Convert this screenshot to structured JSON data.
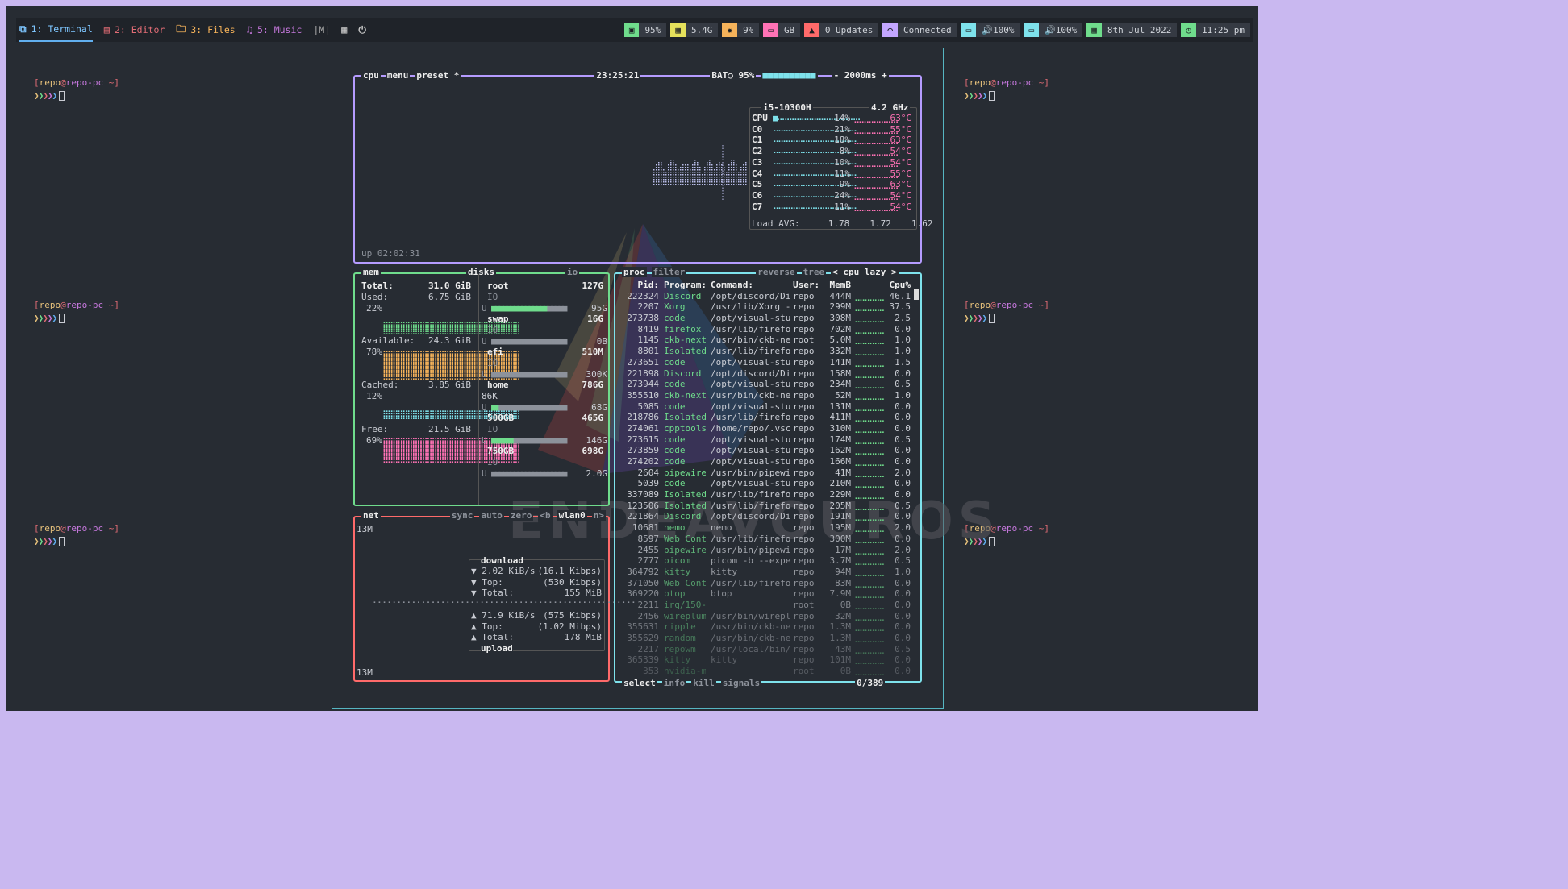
{
  "workspaces": [
    {
      "num": "1: Terminal",
      "icon": "terminal-icon",
      "glyph": "⧉",
      "color": "#7ec6ff",
      "active": true
    },
    {
      "num": "2: Editor",
      "icon": "editor-icon",
      "glyph": "▤",
      "color": "#e06c75"
    },
    {
      "num": "3: Files",
      "icon": "folder-icon",
      "glyph": "🗀",
      "color": "#f6b35a"
    },
    {
      "num": "5: Music",
      "icon": "music-icon",
      "glyph": "♫",
      "color": "#c678dd"
    }
  ],
  "mode": "|M|",
  "modules": [
    {
      "name": "cpu",
      "icon": "cpu-icon",
      "glyph": "▣",
      "color": "#6fdc8c",
      "text": "95%"
    },
    {
      "name": "memory",
      "icon": "memory-icon",
      "glyph": "▦",
      "color": "#e5e15b",
      "text": "5.4G"
    },
    {
      "name": "temperature",
      "icon": "temperature-icon",
      "glyph": "✹",
      "color": "#f6b35a",
      "text": "9%"
    },
    {
      "name": "disk",
      "icon": "disk-icon",
      "glyph": "▭",
      "color": "#ff72b5",
      "text": "GB"
    },
    {
      "name": "updates",
      "icon": "updates-icon",
      "glyph": "▲",
      "color": "#ff6a6a",
      "text": "0 Updates"
    },
    {
      "name": "network",
      "icon": "wifi-icon",
      "glyph": "◠",
      "color": "#c3a6ff",
      "text": "Connected"
    },
    {
      "name": "volume1",
      "icon": "laptop-icon",
      "glyph": "▭",
      "color": "#7ee2ec",
      "text": "🔊100%"
    },
    {
      "name": "volume2",
      "icon": "monitor-icon",
      "glyph": "▭",
      "color": "#7ee2ec",
      "text": "🔊100%"
    },
    {
      "name": "date",
      "icon": "calendar-icon",
      "glyph": "▦",
      "color": "#6fdc8c",
      "text": "8th Jul 2022"
    },
    {
      "name": "clock",
      "icon": "clock-icon",
      "glyph": "◷",
      "color": "#6fdc8c",
      "text": "11:25 pm"
    }
  ],
  "prompt": {
    "user": "repo",
    "host": "repo-pc",
    "dir": "~"
  },
  "cpu": {
    "tabs": [
      "cpu",
      "menu",
      "preset *"
    ],
    "time": "23:25:21",
    "bat": "BAT○ 95%",
    "interval": "- 2000ms +",
    "uptime": "up 02:02:31",
    "model": "i5-10300H",
    "freq": "4.2 GHz",
    "cores": [
      {
        "n": "CPU",
        "p": "14%",
        "t": "63°C"
      },
      {
        "n": "C0",
        "p": "21%",
        "t": "55°C"
      },
      {
        "n": "C1",
        "p": "18%",
        "t": "63°C"
      },
      {
        "n": "C2",
        "p": "8%",
        "t": "54°C"
      },
      {
        "n": "C3",
        "p": "10%",
        "t": "54°C"
      },
      {
        "n": "C4",
        "p": "11%",
        "t": "55°C"
      },
      {
        "n": "C5",
        "p": "9%",
        "t": "63°C"
      },
      {
        "n": "C6",
        "p": "24%",
        "t": "54°C"
      },
      {
        "n": "C7",
        "p": "11%",
        "t": "54°C"
      }
    ],
    "load_label": "Load AVG:",
    "load": [
      "1.78",
      "1.72",
      "1.62"
    ]
  },
  "mem": {
    "title": "mem",
    "total_l": "Total:",
    "total": "31.0 GiB",
    "used_l": "Used:",
    "used": "6.75 GiB",
    "used_p": "22%",
    "avail_l": "Available:",
    "avail": "24.3 GiB",
    "avail_p": "78%",
    "cached_l": "Cached:",
    "cached": "3.85 GiB",
    "cached_p": "12%",
    "free_l": "Free:",
    "free": "21.5 GiB",
    "free_p": "69%"
  },
  "disks": {
    "title": "disks",
    "io": "io",
    "list": [
      {
        "name": "root",
        "size": "127G",
        "u": "95G",
        "fill": 0.75
      },
      {
        "name": "swap",
        "size": "16G",
        "u": "0B",
        "fill": 0.0
      },
      {
        "name": "efi",
        "size": "510M",
        "u": "300K",
        "fill": 0.0
      },
      {
        "name": "home",
        "size": "786G",
        "u": "68G",
        "fill": 0.09,
        "extra": "86K"
      },
      {
        "name": "500GB",
        "size": "465G",
        "u": "146G",
        "fill": 0.31
      },
      {
        "name": "750GB",
        "size": "698G",
        "u": "2.0G",
        "fill": 0.0
      }
    ]
  },
  "net": {
    "title": "net",
    "tabs": [
      "sync",
      "auto",
      "zero",
      "<b",
      "wlan0",
      "n>"
    ],
    "scale_top": "13M",
    "scale_bot": "13M",
    "download": "download",
    "upload": "upload",
    "dl": [
      [
        "▼ 2.02 KiB/s",
        "(16.1 Kibps)"
      ],
      [
        "▼ Top:",
        "(530 Kibps)"
      ],
      [
        "▼ Total:",
        "155 MiB"
      ]
    ],
    "ul": [
      [
        "▲ 71.9 KiB/s",
        "(575 Kibps)"
      ],
      [
        "▲ Top:",
        "(1.02 Mibps)"
      ],
      [
        "▲ Total:",
        "178 MiB"
      ]
    ]
  },
  "proc": {
    "tabs": [
      "proc",
      "filter",
      "reverse",
      "tree",
      "< cpu lazy >"
    ],
    "headers": [
      "Pid:",
      "Program:",
      "Command:",
      "User:",
      "MemB",
      "",
      "Cpu%"
    ],
    "footer": [
      "select",
      "info",
      "kill",
      "signals"
    ],
    "count": "0/389",
    "rows": [
      [
        "222324",
        "Discord",
        "/opt/discord/Di",
        "repo",
        "444M",
        "46.1"
      ],
      [
        "2207",
        "Xorg",
        "/usr/lib/Xorg -",
        "repo",
        "299M",
        "37.5"
      ],
      [
        "273738",
        "code",
        "/opt/visual-stu",
        "repo",
        "308M",
        "2.5"
      ],
      [
        "8419",
        "firefox",
        "/usr/lib/firefo",
        "repo",
        "702M",
        "0.0"
      ],
      [
        "1145",
        "ckb-next",
        "/usr/bin/ckb-ne",
        "root",
        "5.0M",
        "1.0"
      ],
      [
        "8801",
        "Isolated",
        "/usr/lib/firefo",
        "repo",
        "332M",
        "1.0"
      ],
      [
        "273651",
        "code",
        "/opt/visual-stu",
        "repo",
        "141M",
        "1.5"
      ],
      [
        "221898",
        "Discord",
        "/opt/discord/Di",
        "repo",
        "158M",
        "0.0"
      ],
      [
        "273944",
        "code",
        "/opt/visual-stu",
        "repo",
        "234M",
        "0.5"
      ],
      [
        "355510",
        "ckb-next",
        "/usr/bin/ckb-ne",
        "repo",
        "52M",
        "1.0"
      ],
      [
        "5085",
        "code",
        "/opt/visual-stu",
        "repo",
        "131M",
        "0.0"
      ],
      [
        "218786",
        "Isolated",
        "/usr/lib/firefo",
        "repo",
        "411M",
        "0.0"
      ],
      [
        "274061",
        "cpptools",
        "/home/repo/.vsc",
        "repo",
        "310M",
        "0.0"
      ],
      [
        "273615",
        "code",
        "/opt/visual-stu",
        "repo",
        "174M",
        "0.5"
      ],
      [
        "273859",
        "code",
        "/opt/visual-stu",
        "repo",
        "162M",
        "0.0"
      ],
      [
        "274202",
        "code",
        "/opt/visual-stu",
        "repo",
        "166M",
        "0.0"
      ],
      [
        "2604",
        "pipewire",
        "/usr/bin/pipewi",
        "repo",
        "41M",
        "2.0"
      ],
      [
        "5039",
        "code",
        "/opt/visual-stu",
        "repo",
        "210M",
        "0.0"
      ],
      [
        "337089",
        "Isolated",
        "/usr/lib/firefo",
        "repo",
        "229M",
        "0.0"
      ],
      [
        "123506",
        "Isolated",
        "/usr/lib/firefo",
        "repo",
        "205M",
        "0.5"
      ],
      [
        "221864",
        "Discord",
        "/opt/discord/Di",
        "repo",
        "191M",
        "0.0"
      ],
      [
        "10681",
        "nemo",
        "nemo",
        "repo",
        "195M",
        "2.0"
      ],
      [
        "8597",
        "Web Cont",
        "/usr/lib/firefo",
        "repo",
        "300M",
        "0.0"
      ],
      [
        "2455",
        "pipewire",
        "/usr/bin/pipewi",
        "repo",
        "17M",
        "2.0"
      ],
      [
        "2777",
        "picom",
        "picom -b --expe",
        "repo",
        "3.7M",
        "0.5"
      ],
      [
        "364792",
        "kitty",
        "kitty",
        "repo",
        "94M",
        "1.0"
      ],
      [
        "371050",
        "Web Cont",
        "/usr/lib/firefo",
        "repo",
        "83M",
        "0.0"
      ],
      [
        "369220",
        "btop",
        "btop",
        "repo",
        "7.9M",
        "0.0"
      ],
      [
        "2211",
        "irq/150-",
        "",
        "root",
        "0B",
        "0.0"
      ],
      [
        "2456",
        "wireplum",
        "/usr/bin/wirepl",
        "repo",
        "32M",
        "0.0"
      ],
      [
        "355631",
        "ripple",
        "/usr/bin/ckb-ne",
        "repo",
        "1.3M",
        "0.0"
      ],
      [
        "355629",
        "random",
        "/usr/bin/ckb-ne",
        "repo",
        "1.3M",
        "0.0"
      ],
      [
        "2217",
        "repowm",
        "/usr/local/bin/",
        "repo",
        "43M",
        "0.5"
      ],
      [
        "365339",
        "kitty",
        "kitty",
        "repo",
        "101M",
        "0.0"
      ],
      [
        "353",
        "nvidia-m",
        "",
        "root",
        "0B",
        "0.0"
      ]
    ]
  },
  "watermark": "ENDEAVOUROS"
}
